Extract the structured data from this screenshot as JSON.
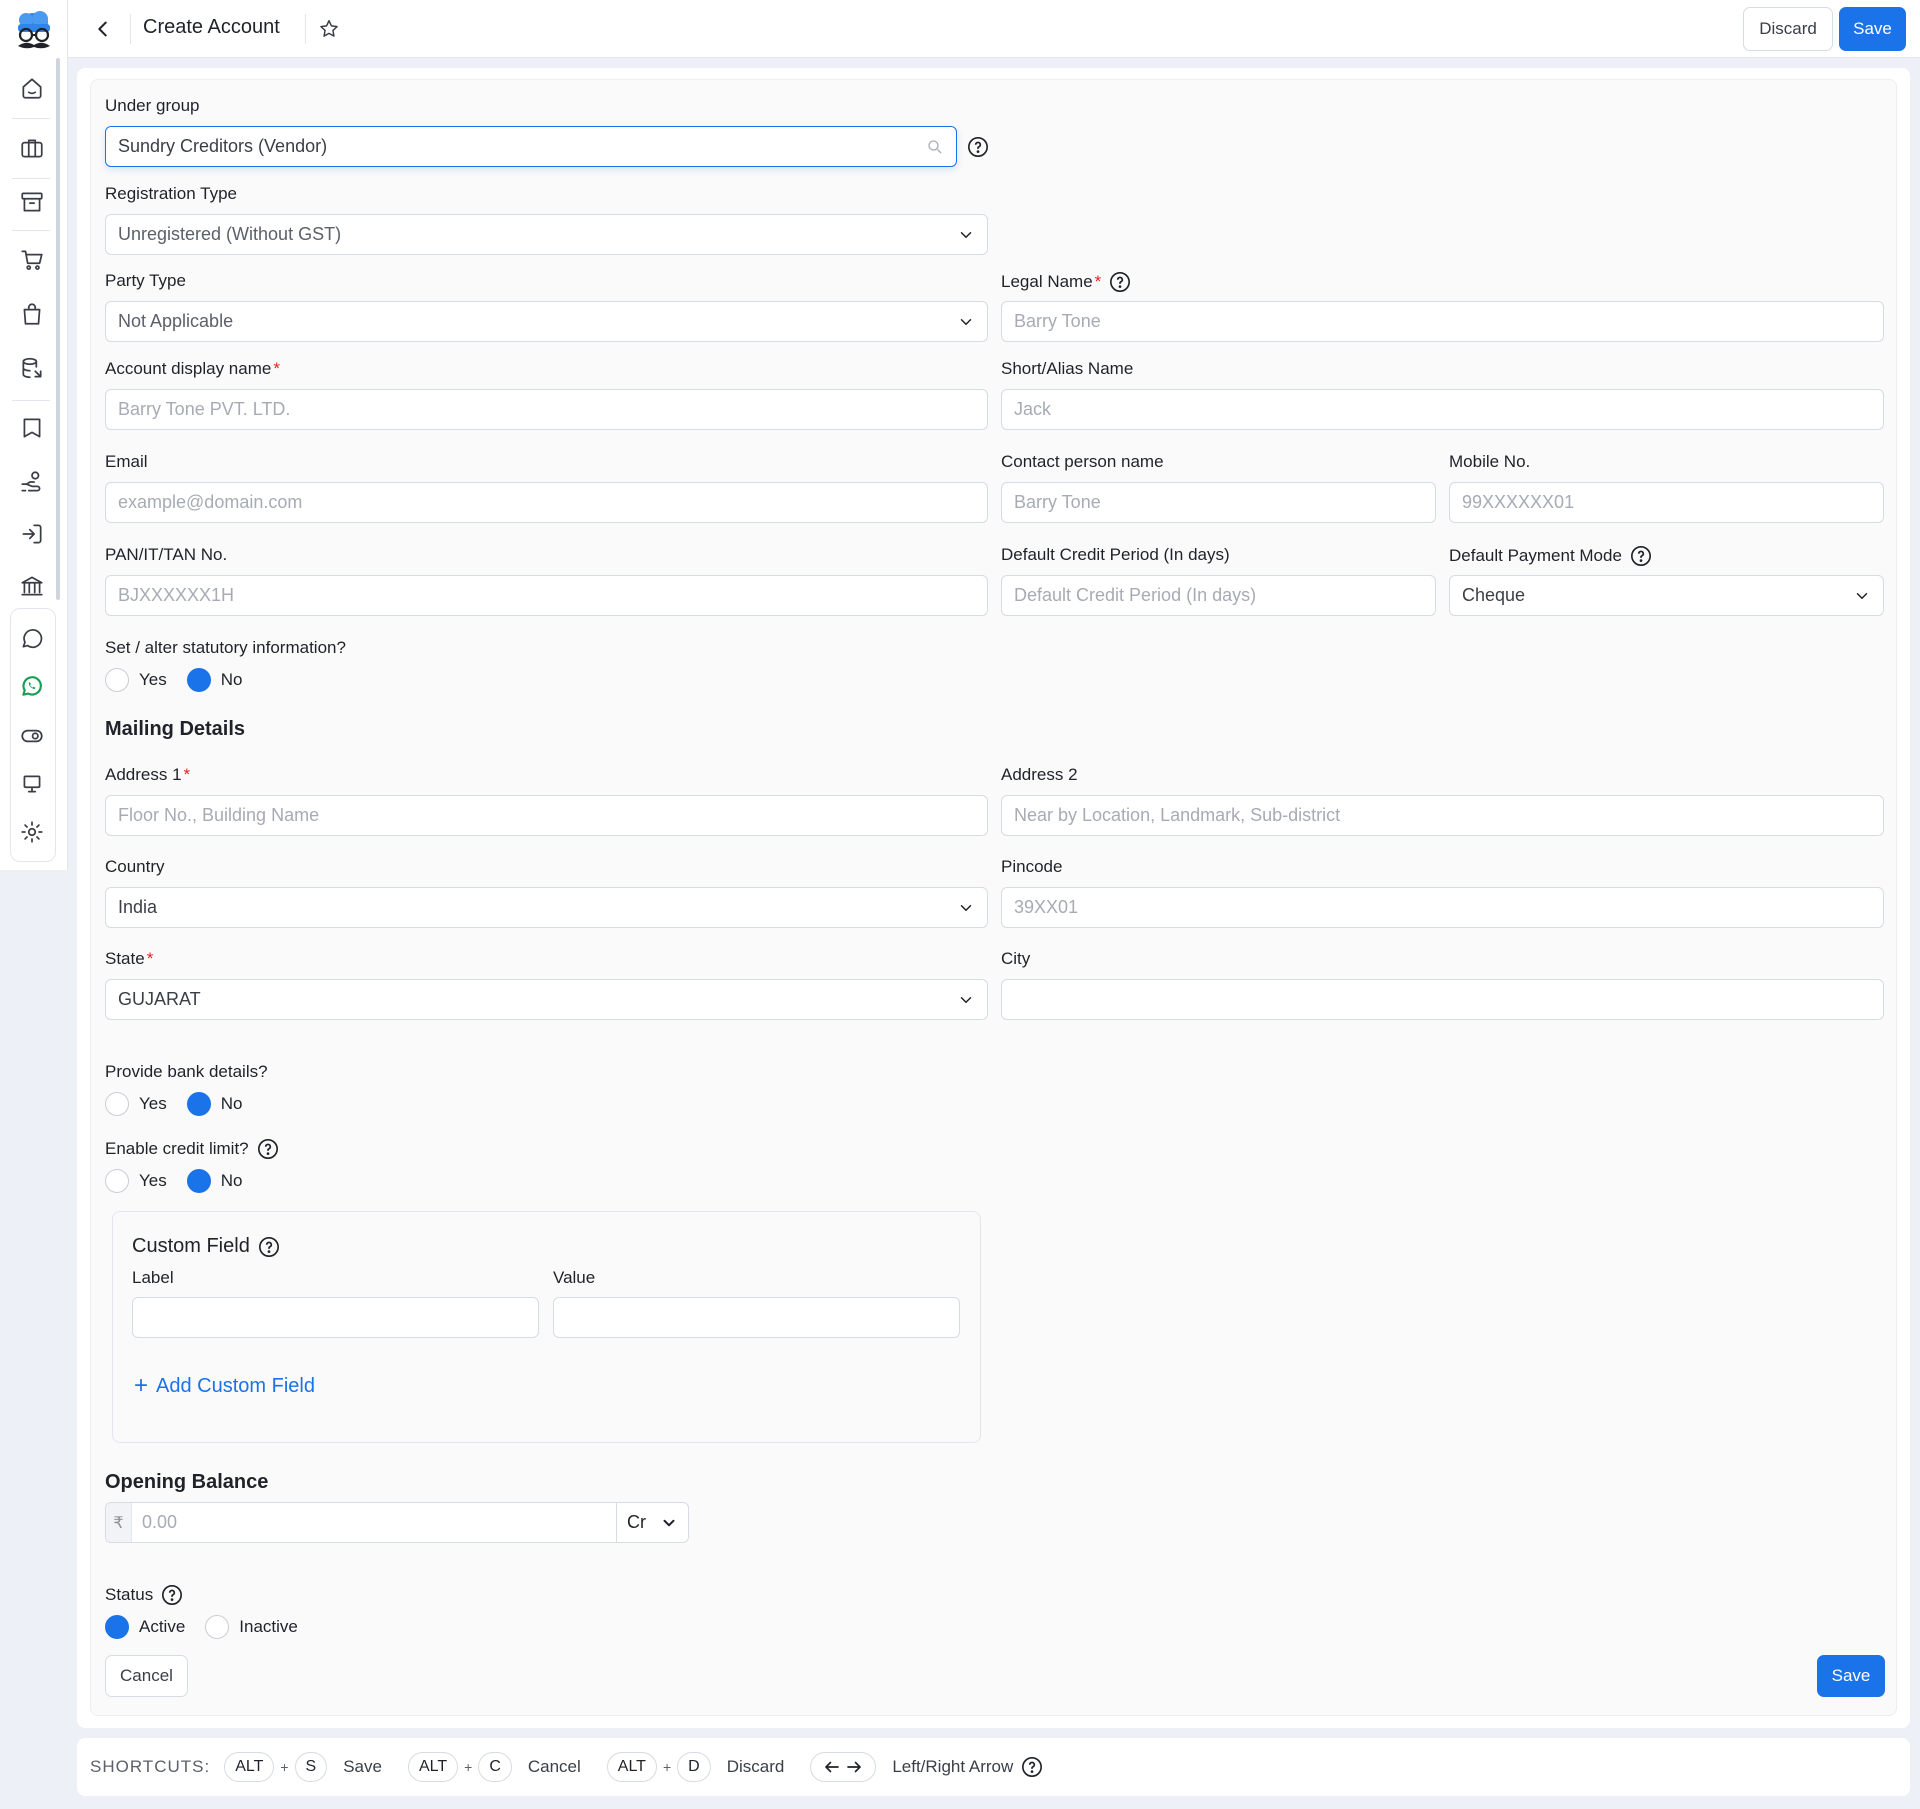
{
  "header": {
    "title": "Create Account",
    "discard_label": "Discard",
    "save_label": "Save"
  },
  "form": {
    "under_group": {
      "label": "Under group",
      "value": "Sundry Creditors (Vendor)"
    },
    "registration_type": {
      "label": "Registration Type",
      "value": "Unregistered (Without GST)"
    },
    "party_type": {
      "label": "Party Type",
      "value": "Not Applicable"
    },
    "legal_name": {
      "label": "Legal Name",
      "required_mark": "*",
      "placeholder": "Barry Tone"
    },
    "account_display_name": {
      "label": "Account display name",
      "required_mark": "*",
      "placeholder": "Barry Tone PVT. LTD."
    },
    "short_alias_name": {
      "label": "Short/Alias Name",
      "placeholder": "Jack"
    },
    "email": {
      "label": "Email",
      "placeholder": "example@domain.com"
    },
    "contact_person_name": {
      "label": "Contact person name",
      "placeholder": "Barry Tone"
    },
    "mobile_no": {
      "label": "Mobile No.",
      "placeholder": "99XXXXXX01"
    },
    "pan_no": {
      "label": "PAN/IT/TAN No.",
      "placeholder": "BJXXXXXX1H"
    },
    "default_credit_period": {
      "label": "Default Credit Period (In days)",
      "placeholder": "Default Credit Period (In days)"
    },
    "default_payment_mode": {
      "label": "Default Payment Mode",
      "value": "Cheque"
    },
    "statutory": {
      "label": "Set / alter statutory information?",
      "yes": "Yes",
      "no": "No",
      "selected": "No"
    },
    "mailing_title": "Mailing Details",
    "address1": {
      "label": "Address 1",
      "required_mark": "*",
      "placeholder": "Floor No., Building Name"
    },
    "address2": {
      "label": "Address 2",
      "placeholder": "Near by Location, Landmark, Sub-district"
    },
    "country": {
      "label": "Country",
      "value": "India"
    },
    "pincode": {
      "label": "Pincode",
      "placeholder": "39XX01"
    },
    "state": {
      "label": "State",
      "required_mark": "*",
      "value": "GUJARAT"
    },
    "city": {
      "label": "City",
      "value": ""
    },
    "bank_details": {
      "label": "Provide bank details?",
      "yes": "Yes",
      "no": "No",
      "selected": "No"
    },
    "credit_limit": {
      "label": "Enable credit limit?",
      "yes": "Yes",
      "no": "No",
      "selected": "No"
    },
    "custom_field": {
      "title": "Custom Field",
      "label_header": "Label",
      "value_header": "Value",
      "add_label": "Add Custom Field"
    },
    "opening_balance": {
      "title": "Opening Balance",
      "currency": "₹",
      "placeholder": "0.00",
      "type": "Cr"
    },
    "status": {
      "label": "Status",
      "active": "Active",
      "inactive": "Inactive",
      "selected": "Active"
    },
    "cancel_label": "Cancel",
    "save_label": "Save"
  },
  "shortcuts": {
    "title": "SHORTCUTS:",
    "items": [
      {
        "mod": "ALT",
        "key": "S",
        "action": "Save"
      },
      {
        "mod": "ALT",
        "key": "C",
        "action": "Cancel"
      },
      {
        "mod": "ALT",
        "key": "D",
        "action": "Discard"
      }
    ],
    "arrow_action": "Left/Right Arrow"
  },
  "colors": {
    "accent": "#1a73e8",
    "required": "#e02424",
    "whatsapp": "#1a9e55"
  },
  "sidebar_icons": [
    "home-icon",
    "briefcase-icon",
    "archive-icon",
    "cart-icon",
    "shopping-bag-icon",
    "database-icon",
    "book-icon",
    "hand-coins-icon",
    "logout-icon",
    "bank-icon",
    "chat-icon",
    "whatsapp-icon",
    "toggle-icon",
    "monitor-icon",
    "settings-icon"
  ]
}
